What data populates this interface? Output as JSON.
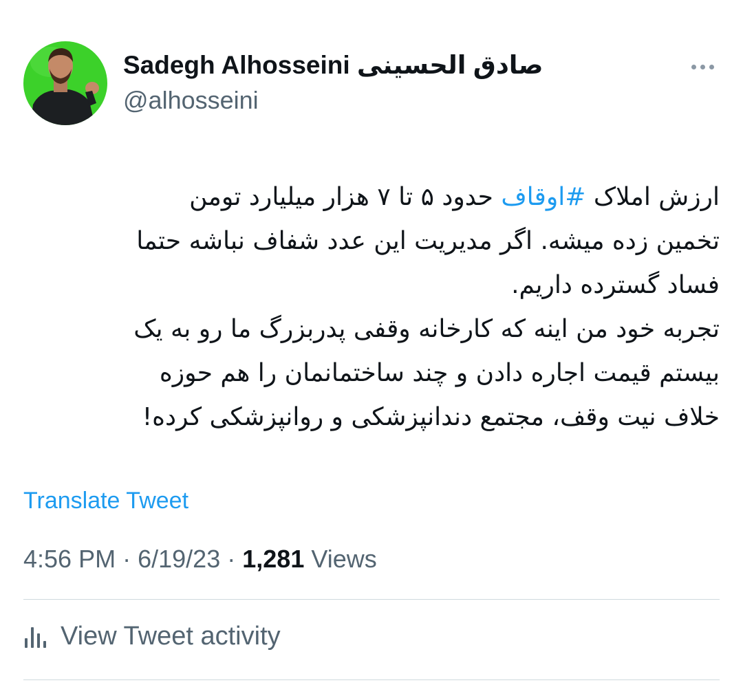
{
  "author": {
    "display_name": "Sadegh Alhosseini صادق الحسینی",
    "handle": "@alhosseini",
    "avatar_icon": "profile-photo",
    "avatar_bg_color": "#3cd12a"
  },
  "more_icon": "more-horizontal-icon",
  "tweet": {
    "lines": [
      {
        "before": "ارزش املاک ",
        "hashtag": "#اوقاف",
        "after": " حدود ۵ تا ۷ هزار میلیارد تومن"
      },
      {
        "text": "تخمین زده میشه. اگر مدیریت این عدد شفاف نباشه حتما"
      },
      {
        "text": "فساد گسترده داریم."
      },
      {
        "text": "تجربه خود من اینه که کارخانه وقفی پدربزرگ ما رو به یک"
      },
      {
        "text": "بیستم قیمت اجاره دادن و چند ساختمانمان را هم حوزه"
      },
      {
        "text": "خلاف نیت وقف، مجتمع دندانپزشکی و روانپزشکی کرده!"
      }
    ],
    "translate_label": "Translate Tweet",
    "time": "4:56 PM",
    "date": "6/19/23",
    "separator": "·",
    "views_count": "1,281",
    "views_label": "Views"
  },
  "activity": {
    "label": "View Tweet activity",
    "icon": "analytics-icon"
  },
  "colors": {
    "link": "#1d9bf0",
    "secondary_text": "#536471",
    "primary_text": "#0f1419",
    "divider": "#cfd9de"
  }
}
